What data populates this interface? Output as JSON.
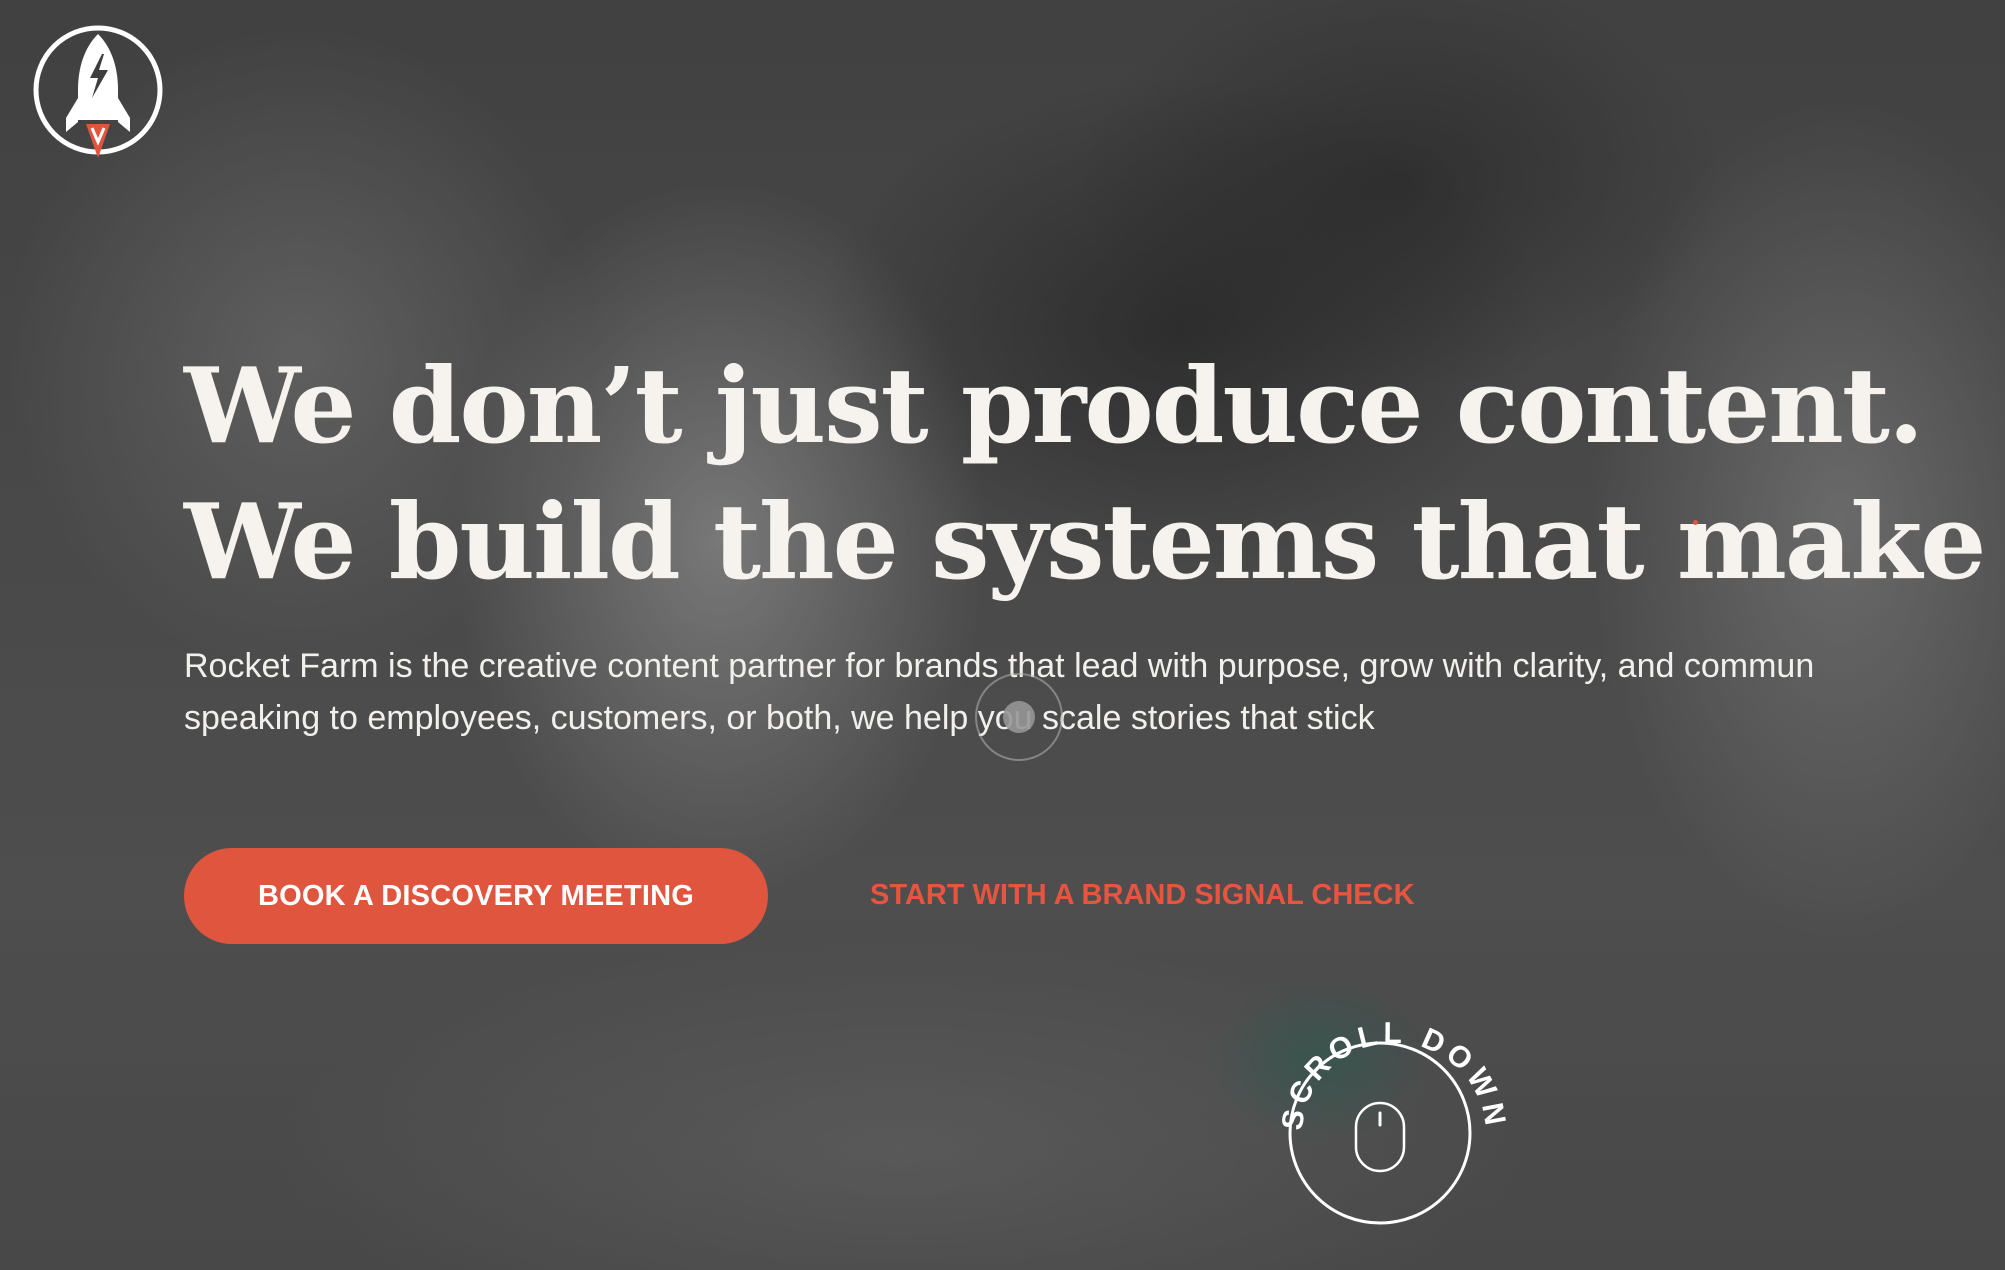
{
  "brand": {
    "logo_icon": "rocket-icon",
    "accent_color": "#e0553e"
  },
  "hero": {
    "headline_line1": "We don’t just produce content.",
    "headline_line2": "We build the systems that make it ma",
    "lede_line1": "Rocket Farm is the creative content partner for brands that lead with purpose, grow with clarity, and commun",
    "lede_line2": "speaking to employees, customers, or both, we help you scale stories that stick"
  },
  "actions": {
    "primary_label": "BOOK A DISCOVERY MEETING",
    "secondary_label": "START WITH A BRAND SIGNAL CHECK"
  },
  "scroll": {
    "label": "SCROLL DOWN",
    "icon": "mouse-icon"
  }
}
